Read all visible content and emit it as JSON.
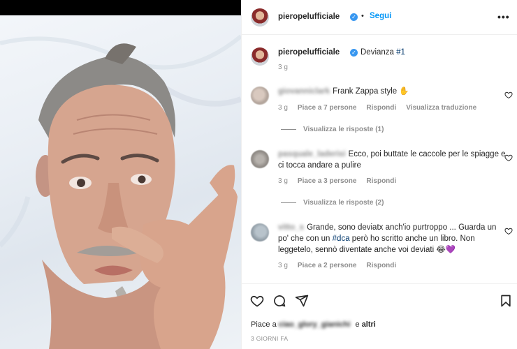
{
  "header": {
    "username": "pieropelufficiale",
    "separator": "•",
    "follow_label": "Segui",
    "more_label": "•••"
  },
  "caption": {
    "username": "pieropelufficiale",
    "text": "Devianza ",
    "hashtag": "#1",
    "time": "3 g"
  },
  "comments": [
    {
      "username": "giovanniclark",
      "text": "Frank Zappa style ✋",
      "time": "3 g",
      "likes": "Piace a 7 persone",
      "reply_label": "Rispondi",
      "translate_label": "Visualizza traduzione",
      "view_replies": "Visualizza le risposte (1)"
    },
    {
      "username": "pasquale_laderisi",
      "text_line1": "Ecco, poi buttate le caccole per le spiagge e",
      "text_line2": "ci tocca andare a pulire",
      "time": "3 g",
      "likes": "Piace a 3 persone",
      "reply_label": "Rispondi",
      "view_replies": "Visualizza le risposte (2)"
    },
    {
      "username": "vitto_s",
      "text_line1": "Grande, sono deviatx anch'io purtroppo ... Guarda un",
      "text_line2_a": "po' che con un ",
      "text_line2_tag": "#dca",
      "text_line2_b": " però ho scritto anche un libro. Non",
      "text_line3": "leggetelo, sennò diventate anche voi deviati 😂💜",
      "time": "3 g",
      "likes": "Piace a 2 persone",
      "reply_label": "Rispondi"
    }
  ],
  "footer": {
    "likes_prefix": "Piace a ",
    "liked_by": "ciao_glory_gianichi",
    "likes_suffix_and": " e ",
    "likes_others": "altri",
    "timestamp": "3 GIORNI FA"
  },
  "icons": {
    "verified": "verified-badge-icon",
    "like": "heart-icon",
    "comment": "comment-icon",
    "share": "share-icon",
    "save": "bookmark-icon"
  },
  "colors": {
    "accent": "#0095f6",
    "verified": "#3897f0",
    "muted": "#8e8e8e",
    "text": "#262626"
  }
}
